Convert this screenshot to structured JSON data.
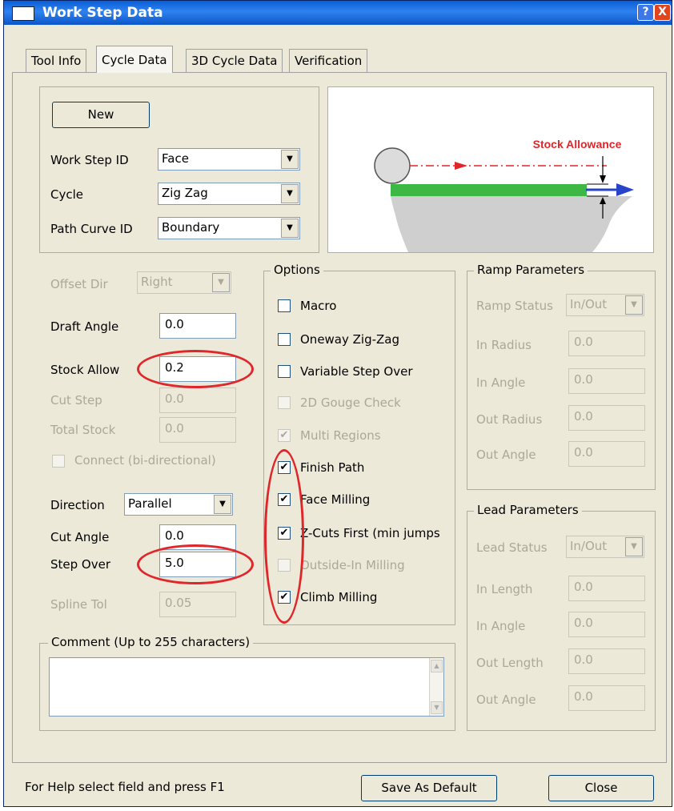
{
  "window": {
    "title": "Work Step Data",
    "help_btn": "?",
    "close_btn": "X"
  },
  "tabs": [
    {
      "label": "Tool Info"
    },
    {
      "label": "Cycle Data"
    },
    {
      "label": "3D Cycle Data"
    },
    {
      "label": "Verification"
    }
  ],
  "top": {
    "new_button": "New",
    "work_step_id": {
      "label": "Work Step ID",
      "value": "Face"
    },
    "cycle": {
      "label": "Cycle",
      "value": "Zig Zag"
    },
    "path_curve_id": {
      "label": "Path Curve ID",
      "value": "Boundary"
    }
  },
  "illustration": {
    "stock_allowance_label": "Stock Allowance",
    "accent": "#e0262a",
    "stock_color": "#3db844",
    "arrow_color": "#2743c9"
  },
  "left": {
    "offset_dir": {
      "label": "Offset Dir",
      "value": "Right"
    },
    "draft_angle": {
      "label": "Draft Angle",
      "value": "0.0"
    },
    "stock_allow": {
      "label": "Stock Allow",
      "value": "0.2"
    },
    "cut_step": {
      "label": "Cut Step",
      "value": "0.0"
    },
    "total_stock": {
      "label": "Total Stock",
      "value": "0.0"
    },
    "connect": {
      "label": "Connect (bi-directional)"
    },
    "direction": {
      "label": "Direction",
      "value": "Parallel"
    },
    "cut_angle": {
      "label": "Cut Angle",
      "value": "0.0"
    },
    "step_over": {
      "label": "Step Over",
      "value": "5.0"
    },
    "spline_tol": {
      "label": "Spline Tol",
      "value": "0.05"
    }
  },
  "options": {
    "title": "Options",
    "items": [
      {
        "label": "Macro",
        "check": ""
      },
      {
        "label": "Oneway Zig-Zag",
        "check": ""
      },
      {
        "label": "Variable Step Over",
        "check": ""
      },
      {
        "label": "2D Gouge Check",
        "check": ""
      },
      {
        "label": "Multi Regions",
        "check": "✔"
      },
      {
        "label": "Finish Path",
        "check": "✔"
      },
      {
        "label": "Face Milling",
        "check": "✔"
      },
      {
        "label": "Z-Cuts First (min jumps",
        "check": "✔"
      },
      {
        "label": "Outside-In Milling",
        "check": ""
      },
      {
        "label": "Climb Milling",
        "check": "✔"
      }
    ]
  },
  "ramp": {
    "title": "Ramp Parameters",
    "status": {
      "label": "Ramp Status",
      "value": "In/Out"
    },
    "in_radius": {
      "label": "In Radius",
      "value": "0.0"
    },
    "in_angle": {
      "label": "In Angle",
      "value": "0.0"
    },
    "out_radius": {
      "label": "Out Radius",
      "value": "0.0"
    },
    "out_angle": {
      "label": "Out Angle",
      "value": "0.0"
    }
  },
  "lead": {
    "title": "Lead Parameters",
    "status": {
      "label": "Lead Status",
      "value": "In/Out"
    },
    "in_length": {
      "label": "In Length",
      "value": "0.0"
    },
    "in_angle": {
      "label": "In Angle",
      "value": "0.0"
    },
    "out_length": {
      "label": "Out Length",
      "value": "0.0"
    },
    "out_angle": {
      "label": "Out Angle",
      "value": "0.0"
    }
  },
  "comment": {
    "title": "Comment  (Up to 255 characters)",
    "value": ""
  },
  "footer": {
    "help_text": "For Help select field and press F1",
    "save_default": "Save As Default",
    "close": "Close"
  }
}
